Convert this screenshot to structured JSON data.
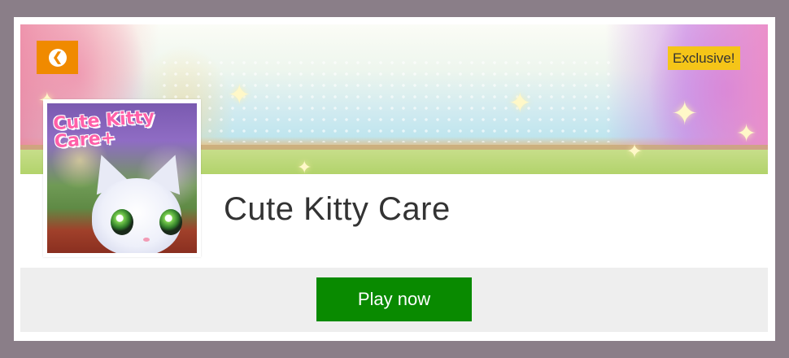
{
  "banner": {
    "back_icon": "chevron-left-icon",
    "badge": "Exclusive!"
  },
  "game": {
    "title": "Cute Kitty Care",
    "thumbnail_title": "Cute Kitty Care+"
  },
  "actions": {
    "play_label": "Play now"
  },
  "colors": {
    "frame": "#8a7e88",
    "back_button": "#f08a00",
    "badge": "#f5c518",
    "play_button": "#098a00",
    "play_bar": "#eeeeee"
  }
}
